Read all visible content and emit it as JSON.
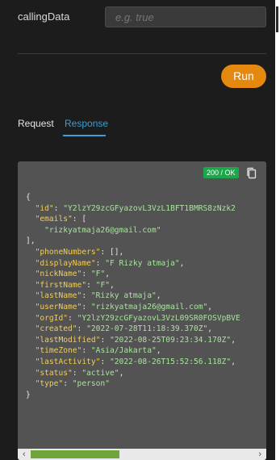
{
  "param": {
    "label": "callingData",
    "placeholder": "e.g. true"
  },
  "run_button": {
    "label": "Run"
  },
  "tabs": {
    "request": "Request",
    "response": "Response",
    "active": "Response"
  },
  "response": {
    "status_badge": "200 / OK",
    "json_open": "{",
    "json_close": "}",
    "lines": [
      {
        "key": "\"id\"",
        "value": "\"Y2lzY29zcGFyazovL3VzL1BFT1BMRS8zNzk2",
        "tail": ""
      },
      {
        "key": "\"emails\"",
        "value": "",
        "tail": "["
      },
      {
        "key": "",
        "value": "\"rizkyatmaja26@gmail.com\"",
        "tail": "",
        "indent": 2
      },
      {
        "key": "",
        "value": "",
        "tail": "],",
        "indent": 0
      },
      {
        "key": "\"phoneNumbers\"",
        "value": "",
        "tail": "[],"
      },
      {
        "key": "\"displayName\"",
        "value": "\"F Rizky atmaja\"",
        "tail": ","
      },
      {
        "key": "\"nickName\"",
        "value": "\"F\"",
        "tail": ","
      },
      {
        "key": "\"firstName\"",
        "value": "\"F\"",
        "tail": ","
      },
      {
        "key": "\"lastName\"",
        "value": "\"Rizky atmaja\"",
        "tail": ","
      },
      {
        "key": "\"userName\"",
        "value": "\"rizkyatmaja26@gmail.com\"",
        "tail": ","
      },
      {
        "key": "\"orgId\"",
        "value": "\"Y2lzY29zcGFyazovL3VzL09SR0FOSVpBVE",
        "tail": ""
      },
      {
        "key": "\"created\"",
        "value": "\"2022-07-28T11:18:39.370Z\"",
        "tail": ","
      },
      {
        "key": "\"lastModified\"",
        "value": "\"2022-08-25T09:23:34.170Z\"",
        "tail": ","
      },
      {
        "key": "\"timeZone\"",
        "value": "\"Asia/Jakarta\"",
        "tail": ","
      },
      {
        "key": "\"lastActivity\"",
        "value": "\"2022-08-26T15:52:56.118Z\"",
        "tail": ","
      },
      {
        "key": "\"status\"",
        "value": "\"active\"",
        "tail": ","
      },
      {
        "key": "\"type\"",
        "value": "\"person\"",
        "tail": ""
      }
    ]
  },
  "scrollbar": {
    "left_arrow": "‹",
    "right_arrow": "›"
  },
  "colors": {
    "accent": "#e5880f",
    "tab_active": "#3a9fd6",
    "status_ok": "#1ba84a",
    "json_key": "#f0cd5a",
    "json_string": "#a9e29f",
    "scroll_thumb": "#6fa53a"
  },
  "icons": {
    "copy": "copy-icon"
  }
}
